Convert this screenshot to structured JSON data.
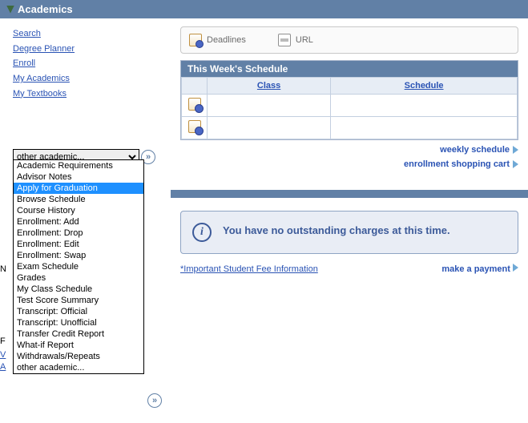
{
  "header": {
    "title": "Academics"
  },
  "left_links": [
    "Search",
    "Degree Planner",
    "Enroll",
    "My Academics",
    "My Textbooks"
  ],
  "dropdown": {
    "selected": "other academic...",
    "options": [
      "Academic Requirements",
      "Advisor Notes",
      "Apply for Graduation",
      "Browse Schedule",
      "Course History",
      "Enrollment: Add",
      "Enrollment: Drop",
      "Enrollment: Edit",
      "Enrollment: Swap",
      "Exam Schedule",
      "Grades",
      "My Class Schedule",
      "Test Score Summary",
      "Transcript: Official",
      "Transcript: Unofficial",
      "Transfer Credit Report",
      "What-if Report",
      "Withdrawals/Repeats",
      "other academic..."
    ],
    "highlighted_index": 2
  },
  "toolbar": {
    "deadlines": "Deadlines",
    "url": "URL"
  },
  "schedule": {
    "title": "This Week's Schedule",
    "columns": {
      "class": "Class",
      "schedule": "Schedule"
    }
  },
  "right_links": {
    "weekly": "weekly schedule",
    "cart": "enrollment shopping cart"
  },
  "info": {
    "message": "You have no outstanding charges at this time."
  },
  "bottom": {
    "fee_link": "*Important Student Fee Information",
    "payment": "make a payment"
  },
  "obscured": {
    "char1": "N",
    "char2": "F",
    "char3": "V",
    "char4": "A"
  }
}
